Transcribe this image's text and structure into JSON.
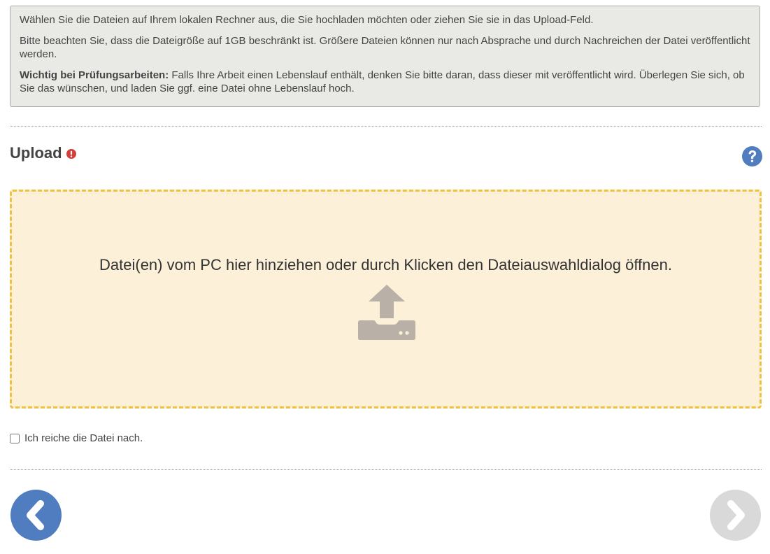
{
  "info": {
    "line1": "Wählen Sie die Dateien auf Ihrem lokalen Rechner aus, die Sie hochladen möchten oder ziehen Sie sie in das Upload-Feld.",
    "line2": "Bitte beachten Sie, dass die Dateigröße auf 1GB beschränkt ist. Größere Dateien können nur nach Absprache und durch Nachreichen der Datei veröffentlicht werden.",
    "important_label": "Wichtig bei Prüfungsarbeiten:",
    "important_text": " Falls Ihre Arbeit einen Lebenslauf enthält, denken Sie bitte daran, dass dieser mit veröffentlicht wird. Überlegen Sie sich, ob Sie das wünschen, und laden Sie ggf. eine Datei ohne Lebenslauf hoch."
  },
  "upload": {
    "title": "Upload",
    "required_icon": "exclamation-circle-icon",
    "help_icon": "question-circle-icon",
    "dropzone_text": "Datei(en) vom PC hier hinziehen oder durch Klicken den Dateiauswahldialog öffnen.",
    "dropzone_icon": "upload-drive-icon"
  },
  "submit_later": {
    "label": "Ich reiche die Datei nach.",
    "checked": false
  },
  "navigation": {
    "prev_icon": "chevron-left-icon",
    "next_icon": "chevron-right-icon",
    "next_enabled": false
  },
  "colors": {
    "info_bg": "#e9eae5",
    "dropzone_bg": "#fcf0d9",
    "dropzone_border": "#efc13d",
    "primary": "#4f7dc0",
    "disabled": "#d9d9d9",
    "required": "#d43f3a",
    "upload_icon": "#b9b1a8"
  }
}
